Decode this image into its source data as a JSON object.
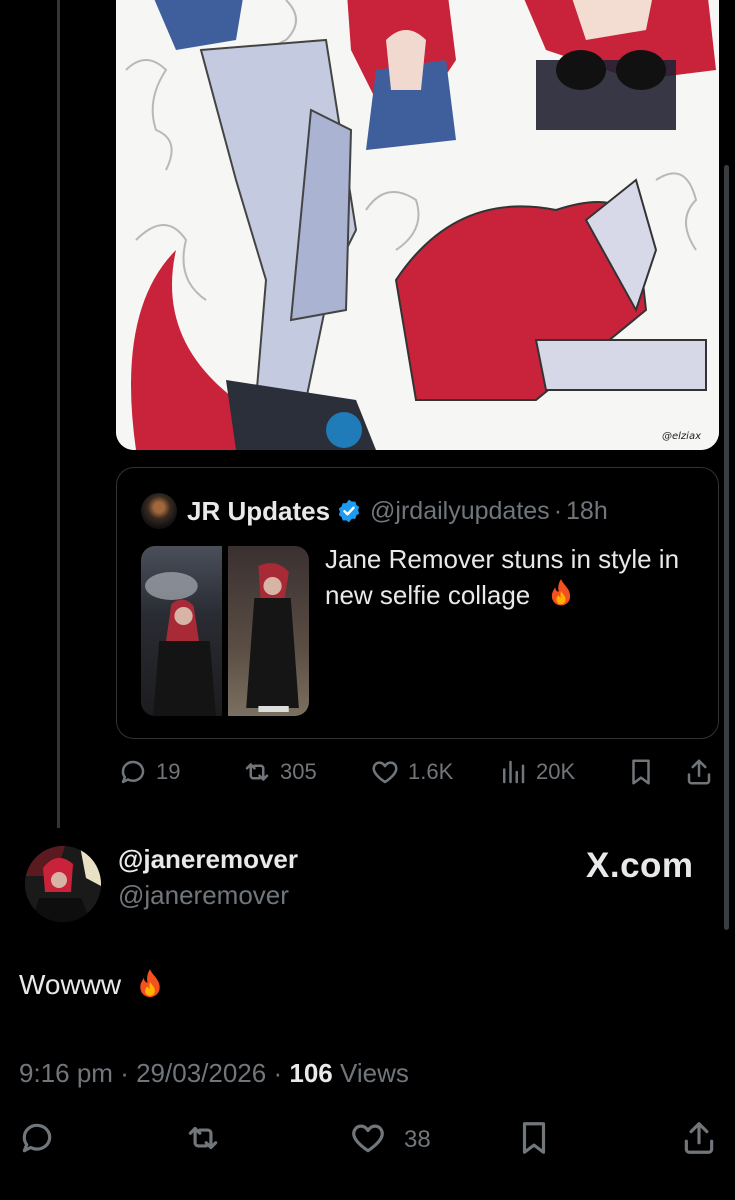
{
  "artwork": {
    "signature": "@elziax"
  },
  "quoted_tweet": {
    "display_name": "JR Updates",
    "handle": "@jrdailyupdates",
    "separator": "·",
    "time": "18h",
    "text": "Jane Remover stuns in style in new selfie collage"
  },
  "quote_actions": {
    "replies": "19",
    "reposts": "305",
    "likes": "1.6K",
    "views": "20K"
  },
  "author": {
    "display_name": "@janeremover",
    "handle": "@janeremover",
    "site": "X.com"
  },
  "post": {
    "text": "Wowww",
    "time": "9:16 pm",
    "separator": "·",
    "date": "29/03/2026",
    "views_count": "106",
    "views_label": "Views"
  },
  "post_actions": {
    "likes": "38"
  },
  "colors": {
    "background": "#000000",
    "text": "#e7e9ea",
    "muted": "#71767b",
    "verified": "#1d9bf0",
    "accent_red": "#c8233a"
  }
}
